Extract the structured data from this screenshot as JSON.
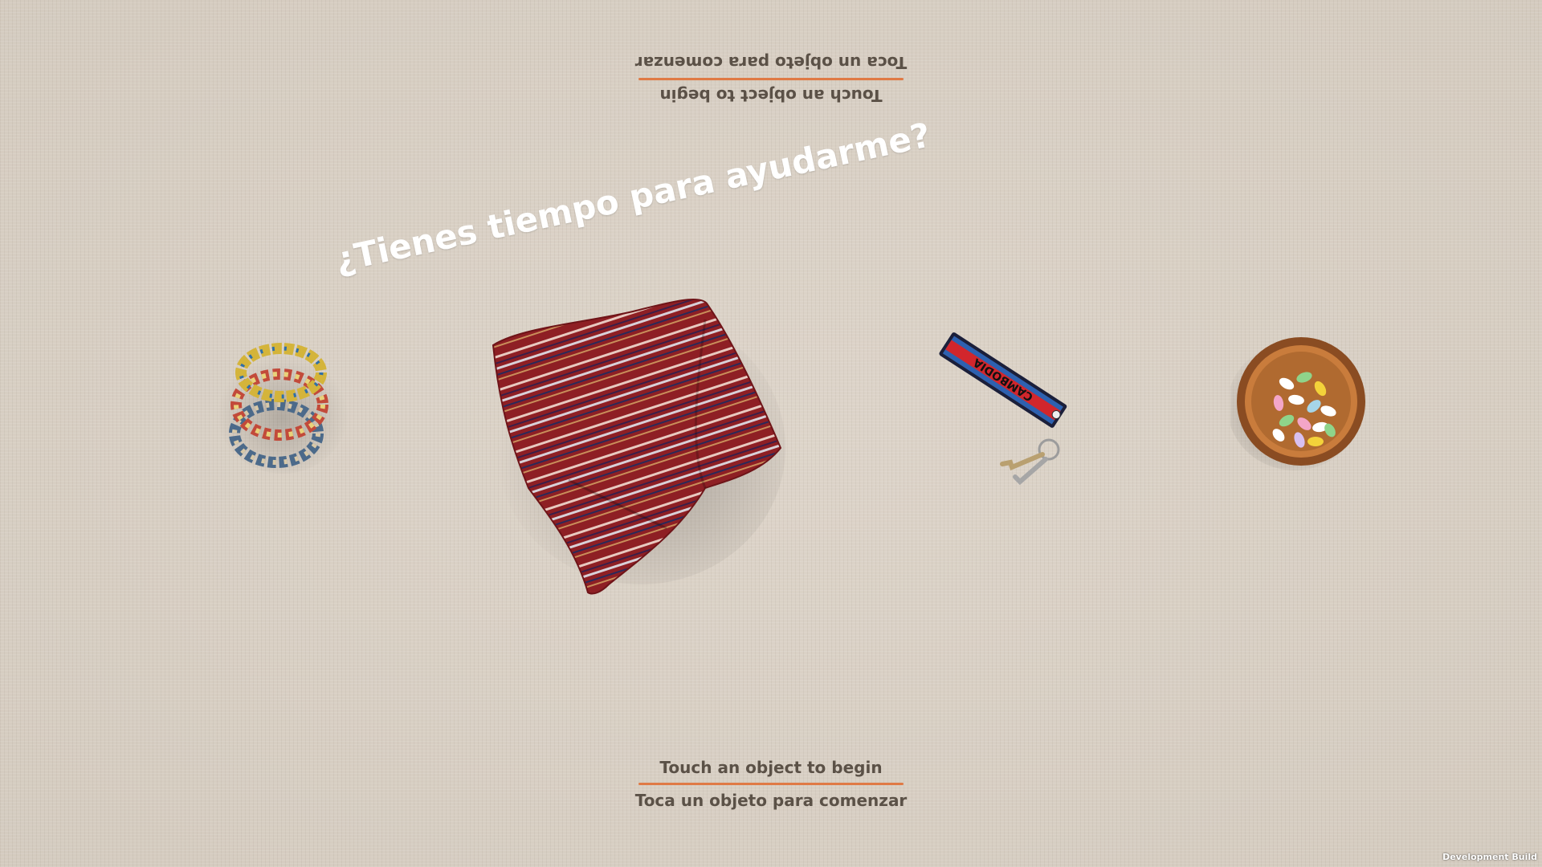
{
  "prompt": {
    "english": "Touch an object to begin",
    "spanish": "Toca un objeto para comenzar"
  },
  "question": "¿Tienes tiempo para ayudarme?",
  "objects": [
    {
      "name": "bracelets"
    },
    {
      "name": "woven textile"
    },
    {
      "name": "keychain",
      "label": "CAMBODIA"
    },
    {
      "name": "candy bowl"
    }
  ],
  "colors": {
    "accent_rule": "#e07a45",
    "prompt_text": "#5b5147",
    "background": "#d9d0c5"
  },
  "footer": {
    "build_label": "Development Build"
  }
}
